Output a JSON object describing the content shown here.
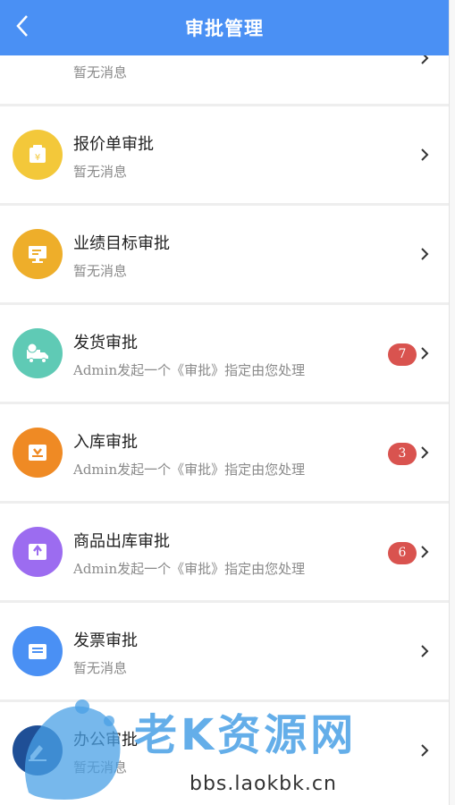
{
  "header": {
    "title": "审批管理"
  },
  "items": [
    {
      "name": "",
      "sub": "暂无消息",
      "badge": "",
      "icon": "document-icon",
      "color": "#e0664a"
    },
    {
      "name": "报价单审批",
      "sub": "暂无消息",
      "badge": "",
      "icon": "yuan-bag-icon",
      "color": "#f3c83a"
    },
    {
      "name": "业绩目标审批",
      "sub": "暂无消息",
      "badge": "",
      "icon": "monitor-icon",
      "color": "#eeae2a"
    },
    {
      "name": "发货审批",
      "sub": "Admin发起一个《审批》指定由您处理",
      "badge": "7",
      "icon": "delivery-truck-icon",
      "color": "#5fcab5"
    },
    {
      "name": "入库审批",
      "sub": "Admin发起一个《审批》指定由您处理",
      "badge": "3",
      "icon": "inbox-icon",
      "color": "#ef8a24"
    },
    {
      "name": "商品出库审批",
      "sub": "Admin发起一个《审批》指定由您处理",
      "badge": "6",
      "icon": "outbox-icon",
      "color": "#9c6cf0"
    },
    {
      "name": "发票审批",
      "sub": "暂无消息",
      "badge": "",
      "icon": "invoice-icon",
      "color": "#4a90f4"
    },
    {
      "name": "办公审批",
      "sub": "暂无消息",
      "badge": "",
      "icon": "office-icon",
      "color": "#1f4f96"
    }
  ],
  "watermark": {
    "text": "老K资源网",
    "url": "bbs.laokbk.cn"
  }
}
